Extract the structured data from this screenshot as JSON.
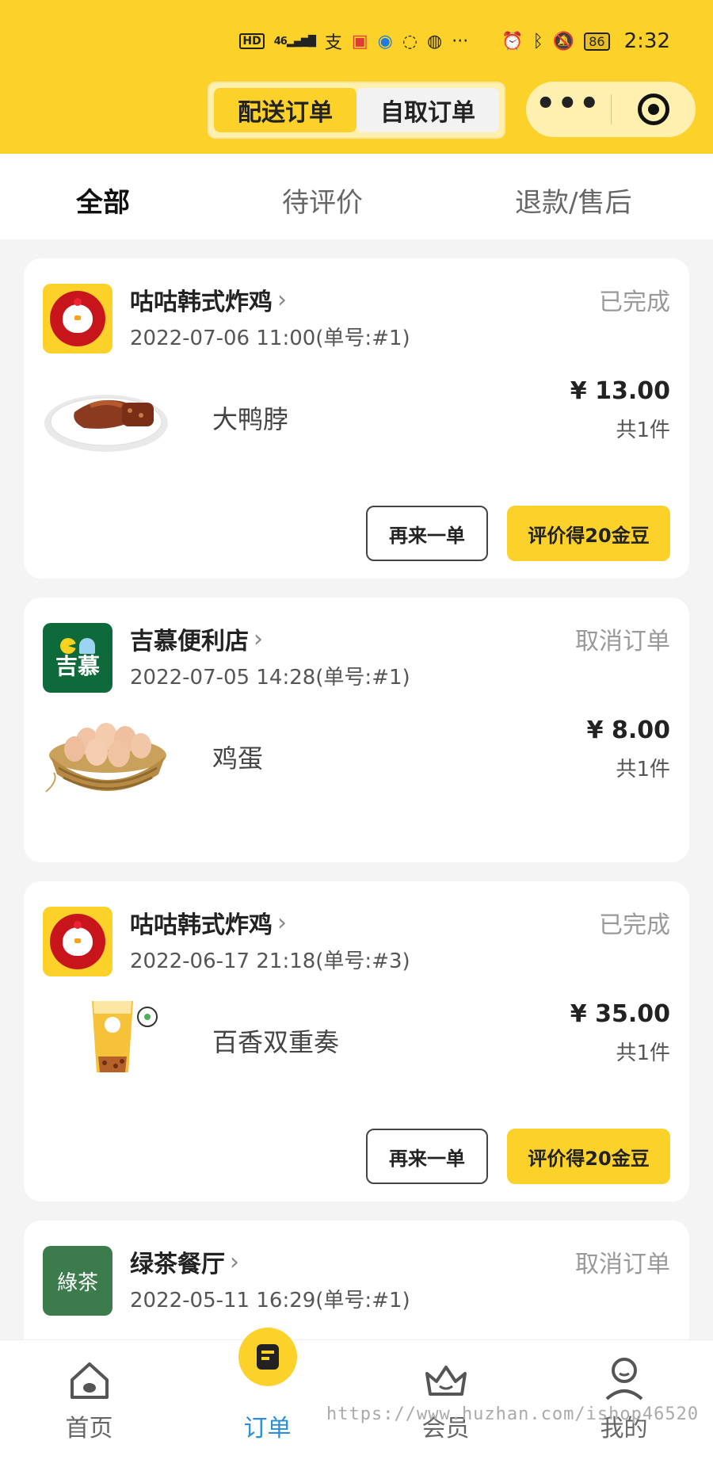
{
  "status_bar": {
    "hd": "HD",
    "signal": "46",
    "battery": "86",
    "time": "2:32"
  },
  "mode_tabs": [
    {
      "label": "配送订单",
      "active": true
    },
    {
      "label": "自取订单",
      "active": false
    }
  ],
  "filter_tabs": [
    {
      "label": "全部",
      "active": true
    },
    {
      "label": "待评价",
      "active": false
    },
    {
      "label": "退款/售后",
      "active": false
    }
  ],
  "orders": [
    {
      "shop": "咕咕韩式炸鸡",
      "status": "已完成",
      "time": "2022-07-06 11:00(单号:#1)",
      "product": "大鸭脖",
      "price": "¥ 13.00",
      "qty": "共1件",
      "reorder_label": "再来一单",
      "review_label": "评价得20金豆"
    },
    {
      "shop": "吉慕便利店",
      "status": "取消订单",
      "time": "2022-07-05 14:28(单号:#1)",
      "product": "鸡蛋",
      "price": "¥ 8.00",
      "qty": "共1件",
      "logo_text": "吉慕"
    },
    {
      "shop": "咕咕韩式炸鸡",
      "status": "已完成",
      "time": "2022-06-17 21:18(单号:#3)",
      "product": "百香双重奏",
      "price": "¥ 35.00",
      "qty": "共1件",
      "reorder_label": "再来一单",
      "review_label": "评价得20金豆"
    },
    {
      "shop": "绿茶餐厅",
      "status": "取消订单",
      "time": "2022-05-11 16:29(单号:#1)",
      "logo_text": "綠茶"
    }
  ],
  "bottom_nav": [
    {
      "label": "首页",
      "icon": "home-icon",
      "active": false
    },
    {
      "label": "订单",
      "icon": "order-icon",
      "active": true
    },
    {
      "label": "会员",
      "icon": "member-icon",
      "active": false
    },
    {
      "label": "我的",
      "icon": "profile-icon",
      "active": false
    }
  ],
  "watermark": "https://www.huzhan.com/ishop46520",
  "colors": {
    "brand_yellow": "#fcd12a",
    "active_blue": "#2b8ed6"
  }
}
